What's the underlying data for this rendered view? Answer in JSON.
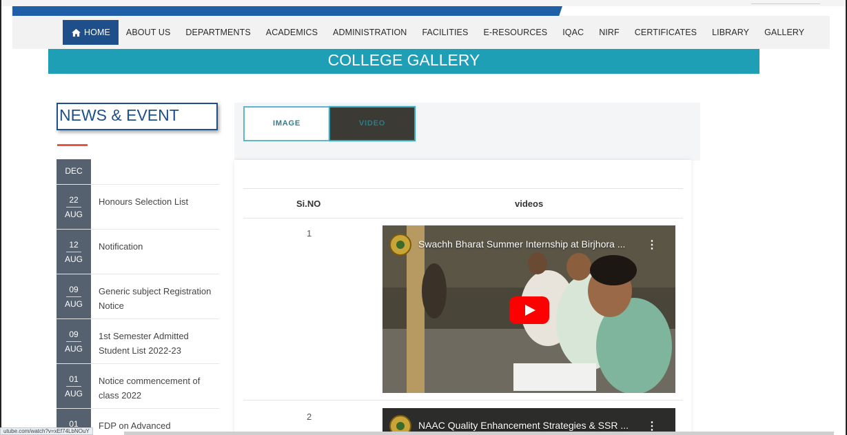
{
  "nav": {
    "items": [
      "HOME",
      "ABOUT US",
      "DEPARTMENTS",
      "ACADEMICS",
      "ADMINISTRATION",
      "FACILITIES",
      "E-RESOURCES",
      "IQAC",
      "NIRF",
      "CERTIFICATES",
      "LIBRARY",
      "GALLERY"
    ],
    "active": "HOME",
    "home_icon": "home-icon"
  },
  "page": {
    "banner": "COLLEGE GALLERY"
  },
  "news": {
    "title": "NEWS & EVENT",
    "items": [
      {
        "day": "",
        "month": "DEC",
        "text": ""
      },
      {
        "day": "22",
        "month": "AUG",
        "text": "Honours Selection List"
      },
      {
        "day": "12",
        "month": "AUG",
        "text": "Notification"
      },
      {
        "day": "09",
        "month": "AUG",
        "text": "Generic subject Registration Notice"
      },
      {
        "day": "09",
        "month": "AUG",
        "text": "1st Semester Admitted Student List 2022-23"
      },
      {
        "day": "01",
        "month": "AUG",
        "text": "Notice commencement of class 2022"
      },
      {
        "day": "01",
        "month": "",
        "text": "FDP on Advanced"
      }
    ]
  },
  "tabs": {
    "image": "IMAGE",
    "video": "VIDEO",
    "active": "VIDEO"
  },
  "table": {
    "headers": {
      "sino": "Si.NO",
      "videos": "videos"
    },
    "rows": [
      {
        "num": "1",
        "title": "Swachh Bharat Summer Internship at Birjhora ...",
        "menu": "⋮"
      },
      {
        "num": "2",
        "title": "NAAC Quality Enhancement Strategies & SSR ...",
        "menu": "⋮"
      }
    ]
  },
  "status": {
    "url": "utube.com/watch?v=xEf74LbNOuY"
  },
  "colors": {
    "primary": "#1e4f8a",
    "teal": "#1f9fb6",
    "accent": "#e8553b",
    "date_bg": "#566170",
    "play": "#ff0000"
  }
}
